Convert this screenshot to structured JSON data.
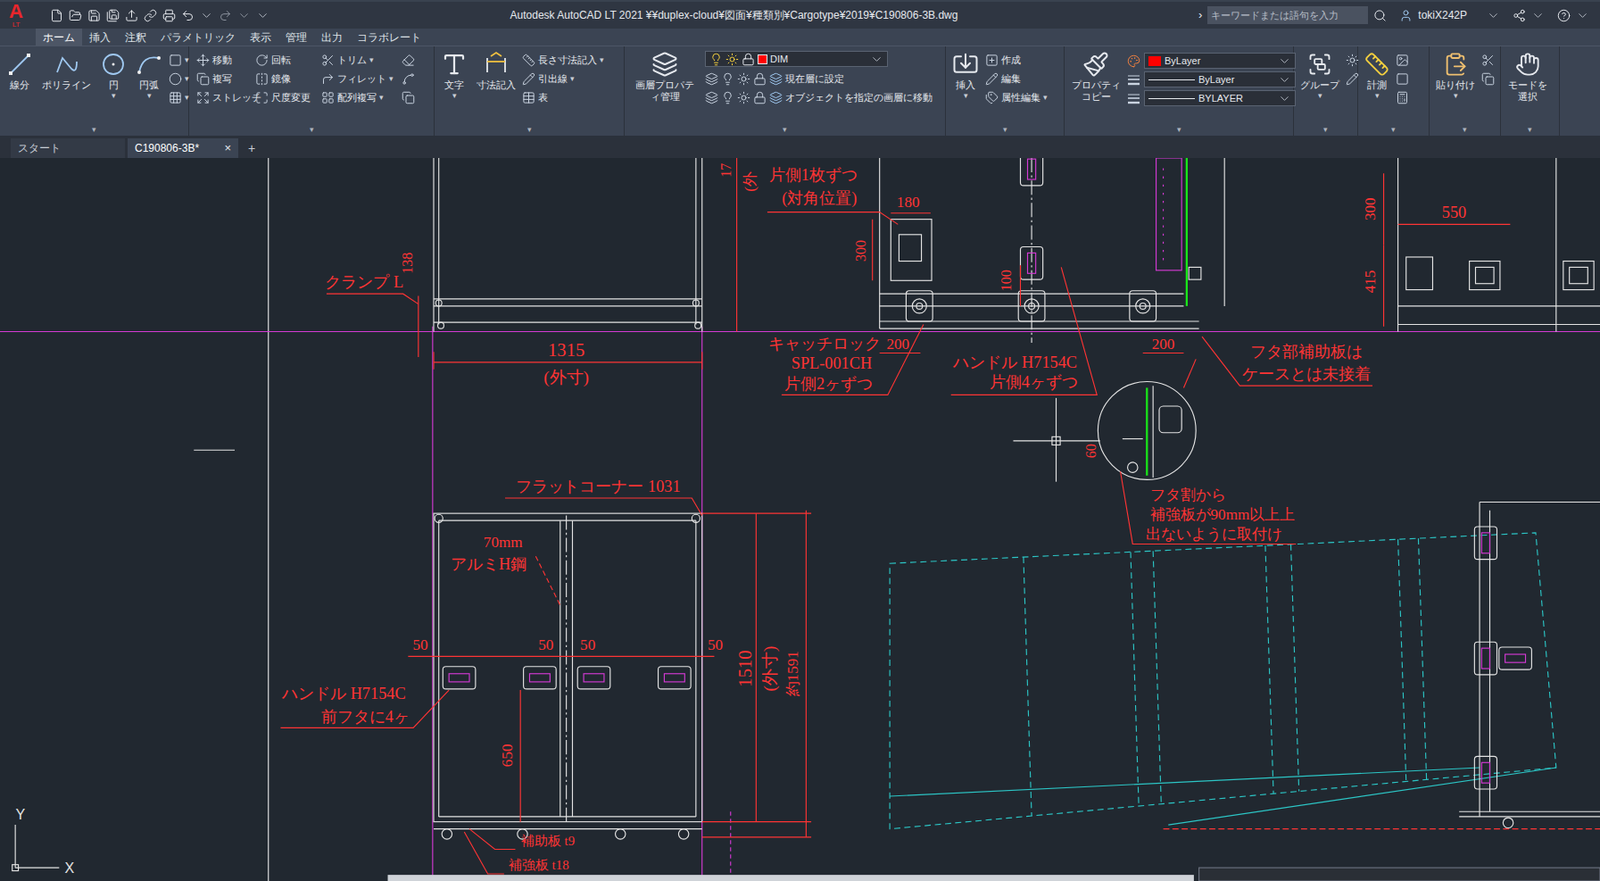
{
  "window": {
    "title": "Autodesk AutoCAD LT 2021   ¥¥duplex-cloud¥図面¥種類別¥Cargotype¥2019¥C190806-3B.dwg"
  },
  "app_logo": {
    "letter": "A",
    "edition": "LT"
  },
  "search": {
    "placeholder": "キーワードまたは語句を入力",
    "expand": "›"
  },
  "user": {
    "name": "tokiX242P"
  },
  "caret": "▾",
  "ribbon_tabs": [
    {
      "label": "ホーム",
      "selected": true
    },
    {
      "label": "挿入",
      "selected": false
    },
    {
      "label": "注釈",
      "selected": false
    },
    {
      "label": "パラメトリック",
      "selected": false
    },
    {
      "label": "表示",
      "selected": false
    },
    {
      "label": "管理",
      "selected": false
    },
    {
      "label": "出力",
      "selected": false
    },
    {
      "label": "コラボレート",
      "selected": false
    }
  ],
  "ribbon": {
    "draw": [
      {
        "label": "線分",
        "dropdown": false
      },
      {
        "label": "ポリライン",
        "dropdown": false
      },
      {
        "label": "円",
        "dropdown": true
      },
      {
        "label": "円弧",
        "dropdown": true
      }
    ],
    "modify": [
      [
        {
          "label": "移動",
          "dropdown": false
        },
        {
          "label": "回転",
          "dropdown": false
        },
        {
          "label": "トリム",
          "dropdown": true
        }
      ],
      [
        {
          "label": "複写",
          "dropdown": false
        },
        {
          "label": "鏡像",
          "dropdown": false
        },
        {
          "label": "フィレット",
          "dropdown": true
        }
      ],
      [
        {
          "label": "ストレッチ",
          "dropdown": false
        },
        {
          "label": "尺度変更",
          "dropdown": false
        },
        {
          "label": "配列複写",
          "dropdown": true
        }
      ]
    ],
    "annotation": {
      "large": [
        {
          "label": "文字",
          "dropdown": true
        },
        {
          "label": "寸法記入",
          "dropdown": false
        }
      ],
      "small": [
        {
          "label": "長さ寸法記入",
          "dropdown": true
        },
        {
          "label": "引出線",
          "dropdown": true
        },
        {
          "label": "表",
          "dropdown": false
        }
      ]
    },
    "layers": {
      "large": {
        "label": "画層プロパティ管理"
      },
      "current_layer": {
        "name": "DIM",
        "color": "#ff0000"
      },
      "actions": [
        "現在層に設定",
        "オブジェクトを指定の画層に移動"
      ]
    },
    "block": {
      "large": {
        "label": "挿入",
        "dropdown": true
      },
      "small": [
        {
          "label": "作成",
          "dropdown": false
        },
        {
          "label": "編集",
          "dropdown": false
        },
        {
          "label": "属性編集",
          "dropdown": true
        }
      ]
    },
    "properties": {
      "large": {
        "label": "プロパティコピー"
      },
      "color": {
        "value": "ByLayer",
        "swatch": "#ff0000"
      },
      "lineweight": "ByLayer",
      "linetype": "BYLAYER"
    },
    "groups": {
      "label": "グループ",
      "dropdown": true
    },
    "utilities": {
      "label": "計測",
      "dropdown": true
    },
    "clipboard": {
      "label": "貼り付け",
      "dropdown": true
    },
    "select_mode": {
      "label": "モードを選択"
    }
  },
  "document_tabs": [
    {
      "label": "スタート",
      "selected": false,
      "closable": false
    },
    {
      "label": "C190806-3B*",
      "selected": true,
      "closable": true
    }
  ],
  "close_glyph": "×",
  "new_tab": "+",
  "drawing": {
    "annotations": [
      {
        "text": "17"
      },
      {
        "text": "(外"
      },
      {
        "text": "片側1枚ずつ"
      },
      {
        "text": "(対角位置)"
      },
      {
        "text": "180"
      },
      {
        "text": "300"
      },
      {
        "text": "138"
      },
      {
        "text": "クランプ L"
      },
      {
        "text": "1315"
      },
      {
        "text": "(外寸)"
      },
      {
        "text": "キャッチロック"
      },
      {
        "text": "SPL-001CH"
      },
      {
        "text": "片側2ヶずつ"
      },
      {
        "text": "200"
      },
      {
        "text": "200"
      },
      {
        "text": "ハンドル H7154C"
      },
      {
        "text": "片側4ヶずつ"
      },
      {
        "text": "フタ部補助板は"
      },
      {
        "text": "ケースとは未接着"
      },
      {
        "text": "100"
      },
      {
        "text": "300"
      },
      {
        "text": "550"
      },
      {
        "text": "415"
      },
      {
        "text": "60"
      },
      {
        "text": "フタ割から"
      },
      {
        "text": "補強板が90mm以上上"
      },
      {
        "text": "出ないように取付け"
      },
      {
        "text": "フラットコーナー 1031"
      },
      {
        "text": "70mm"
      },
      {
        "text": "アルミH鋼"
      },
      {
        "text": "50"
      },
      {
        "text": "50"
      },
      {
        "text": "50"
      },
      {
        "text": "50"
      },
      {
        "text": "ハンドル H7154C"
      },
      {
        "text": "前フタに4ヶ"
      },
      {
        "text": "650"
      },
      {
        "text": "1510"
      },
      {
        "text": "(外寸)"
      },
      {
        "text": "約1591"
      },
      {
        "text": "補助板 t9"
      },
      {
        "text": "補強板 t18"
      }
    ],
    "ucs": {
      "x": "X",
      "y": "Y"
    }
  }
}
